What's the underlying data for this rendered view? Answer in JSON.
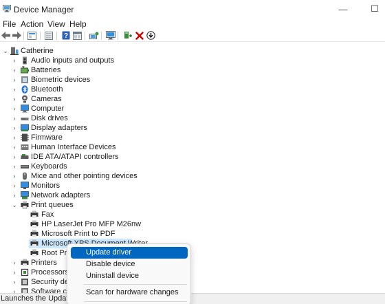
{
  "window": {
    "title": "Device Manager",
    "icon": "device-manager-icon",
    "minimize": "—",
    "maximize": "☐"
  },
  "menu": [
    "File",
    "Action",
    "View",
    "Help"
  ],
  "toolbar": {
    "icons": [
      "back-arrow-icon",
      "forward-arrow-icon",
      "properties-icon",
      "details-icon",
      "help-icon",
      "view-icon",
      "computer-scan-icon",
      "monitor-icon",
      "add-driver-icon",
      "uninstall-icon",
      "download-icon"
    ]
  },
  "tree": {
    "root": {
      "label": "Catherine",
      "expanded": true
    },
    "categories": [
      {
        "label": "Audio inputs and outputs",
        "icon": "speaker-icon",
        "expanded": false
      },
      {
        "label": "Batteries",
        "icon": "battery-icon",
        "expanded": false
      },
      {
        "label": "Biometric devices",
        "icon": "biometric-icon",
        "expanded": false
      },
      {
        "label": "Bluetooth",
        "icon": "bluetooth-icon",
        "expanded": false
      },
      {
        "label": "Cameras",
        "icon": "camera-icon",
        "expanded": false
      },
      {
        "label": "Computer",
        "icon": "computer-icon",
        "expanded": false
      },
      {
        "label": "Disk drives",
        "icon": "disk-icon",
        "expanded": false
      },
      {
        "label": "Display adapters",
        "icon": "display-icon",
        "expanded": false
      },
      {
        "label": "Firmware",
        "icon": "firmware-icon",
        "expanded": false
      },
      {
        "label": "Human Interface Devices",
        "icon": "hid-icon",
        "expanded": false
      },
      {
        "label": "IDE ATA/ATAPI controllers",
        "icon": "ide-icon",
        "expanded": false
      },
      {
        "label": "Keyboards",
        "icon": "keyboard-icon",
        "expanded": false
      },
      {
        "label": "Mice and other pointing devices",
        "icon": "mouse-icon",
        "expanded": false
      },
      {
        "label": "Monitors",
        "icon": "monitor-icon",
        "expanded": false
      },
      {
        "label": "Network adapters",
        "icon": "network-icon",
        "expanded": false
      },
      {
        "label": "Print queues",
        "icon": "printer-icon",
        "expanded": true
      }
    ],
    "print_queue_children": [
      {
        "label": "Fax"
      },
      {
        "label": "HP LaserJet Pro MFP M26nw"
      },
      {
        "label": "Microsoft Print to PDF"
      },
      {
        "label": "Microsoft XPS Document Writer",
        "selected": true
      },
      {
        "label": "Root Prin"
      }
    ],
    "after_categories": [
      {
        "label": "Printers",
        "icon": "printer-icon",
        "expanded": false
      },
      {
        "label": "Processors",
        "icon": "processor-icon",
        "expanded": false
      },
      {
        "label": "Security dev",
        "icon": "security-icon",
        "expanded": false
      },
      {
        "label": "Software cor",
        "icon": "software-icon",
        "expanded": false
      }
    ]
  },
  "context_menu": {
    "items": [
      {
        "label": "Update driver",
        "highlighted": true
      },
      {
        "label": "Disable device"
      },
      {
        "label": "Uninstall device"
      },
      {
        "label": "Scan for hardware changes"
      }
    ]
  },
  "status": {
    "text": "Launches the Update Dr"
  },
  "colors": {
    "selection": "#cce8ff",
    "menu_highlight": "#0067c0",
    "uninstall_red": "#d40000"
  }
}
